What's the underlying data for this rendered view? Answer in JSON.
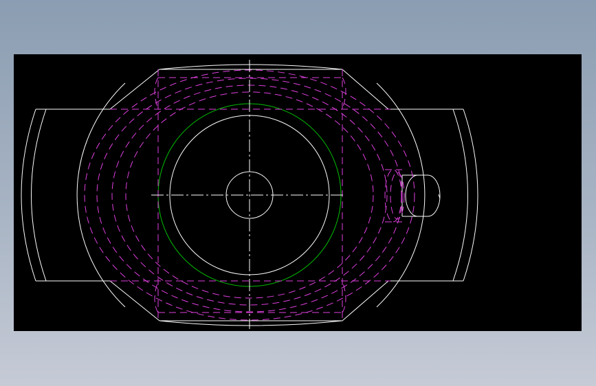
{
  "drawing": {
    "background": "#8b9db2",
    "canvas_color": "#000000",
    "colors": {
      "outline": "#ffffff",
      "hidden": "#e040e0",
      "centerline": "#ffffff",
      "pitch_circle": "#00c000"
    },
    "line_types": {
      "outline": "continuous",
      "hidden": "dashed",
      "centerline": "dash-dot"
    }
  }
}
